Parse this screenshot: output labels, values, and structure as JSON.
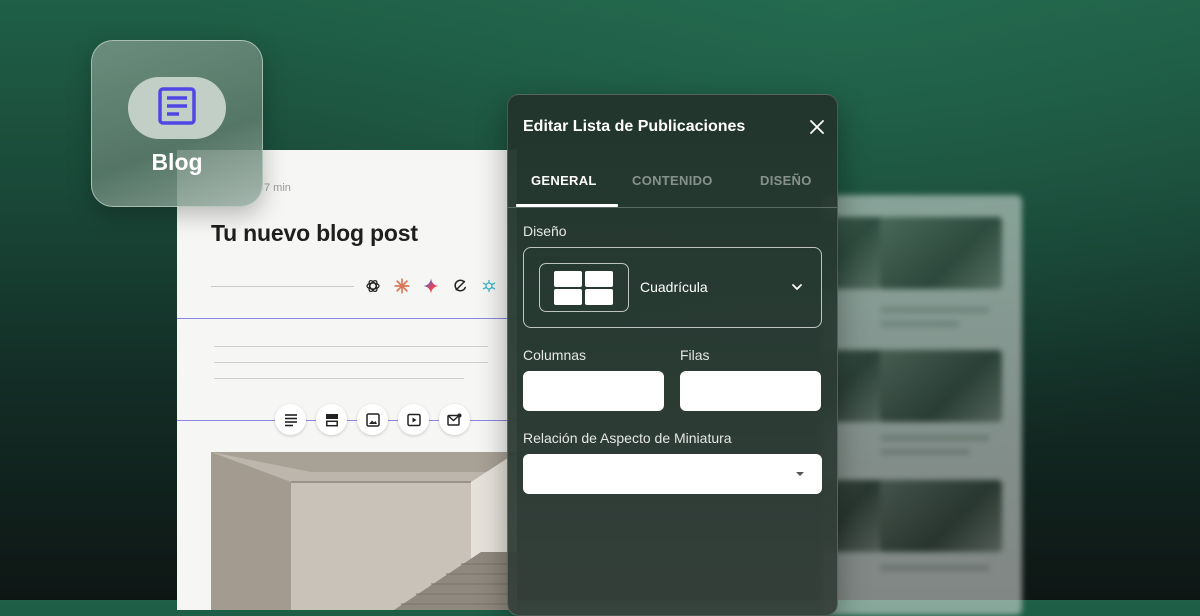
{
  "blog_tile": {
    "label": "Blog",
    "icon": "article-icon",
    "accent": "#4f46e5"
  },
  "editor": {
    "read_time": "7 min",
    "title": "Tu nuevo blog post",
    "ai_icons": [
      "openai-icon",
      "claude-icon",
      "gemini-icon",
      "perplexity-icon",
      "deepseek-icon"
    ],
    "toolbar_icons": [
      "paragraph-icon",
      "layout-blocks-icon",
      "image-icon",
      "video-icon",
      "newsletter-icon"
    ],
    "guide_color": "#8c86e0"
  },
  "panel": {
    "title": "Editar Lista de Publicaciones",
    "tabs": [
      {
        "label": "GENERAL",
        "active": true
      },
      {
        "label": "CONTENIDO",
        "active": false
      },
      {
        "label": "DISEÑO",
        "active": false
      }
    ],
    "layout_label": "Diseño",
    "layout_value": "Cuadrícula",
    "columns_label": "Columnas",
    "rows_label": "Filas",
    "columns_value": "",
    "rows_value": "",
    "aspect_label": "Relación de Aspecto de Miniatura",
    "aspect_value": ""
  }
}
